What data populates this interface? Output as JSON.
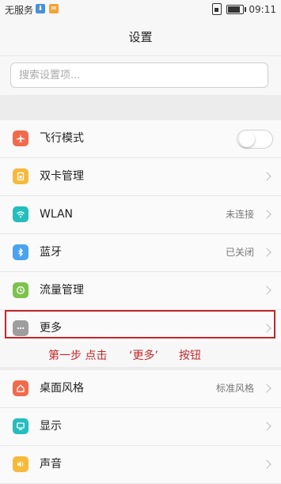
{
  "status_bar": {
    "carrier": "无服务",
    "time": "09:11",
    "battery_level": 0.85
  },
  "header": {
    "title": "设置"
  },
  "search": {
    "placeholder": "搜索设置项..."
  },
  "group1": [
    {
      "label": "飞行模式",
      "icon": "airplane-icon",
      "icon_color": "#f26a4b",
      "control": "toggle",
      "toggle_on": false
    },
    {
      "label": "双卡管理",
      "icon": "sim-card-icon",
      "icon_color": "#f6b93b",
      "control": "chevron"
    },
    {
      "label": "WLAN",
      "value": "未连接",
      "icon": "wifi-icon",
      "icon_color": "#26bdbd",
      "control": "chevron"
    },
    {
      "label": "蓝牙",
      "value": "已关闭",
      "icon": "bluetooth-icon",
      "icon_color": "#4aa3f0",
      "control": "chevron"
    },
    {
      "label": "流量管理",
      "icon": "data-usage-icon",
      "icon_color": "#7cc24d",
      "control": "chevron"
    },
    {
      "label": "更多",
      "icon": "more-icon",
      "icon_color": "#9e9e9e",
      "control": "chevron"
    }
  ],
  "annotation": {
    "part1": "第一步 点击",
    "part2": "‘更多’",
    "part3": "按钮",
    "color": "#c0282b"
  },
  "group2": [
    {
      "label": "桌面风格",
      "value": "标准风格",
      "icon": "home-icon",
      "icon_color": "#f26a4b",
      "control": "chevron"
    },
    {
      "label": "显示",
      "icon": "display-icon",
      "icon_color": "#26bdbd",
      "control": "chevron"
    },
    {
      "label": "声音",
      "icon": "sound-icon",
      "icon_color": "#f6b93b",
      "control": "chevron"
    }
  ]
}
